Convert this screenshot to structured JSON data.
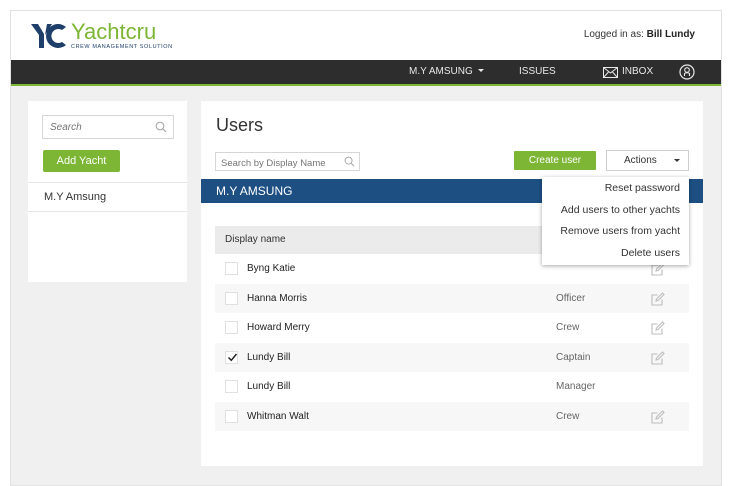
{
  "header": {
    "logo_name": "Yachtcru",
    "logo_tagline": "CREW MANAGEMENT SOLUTION",
    "logged_in_label": "Logged in as:",
    "logged_in_user": "Bill Lundy"
  },
  "nav": {
    "yacht": "M.Y AMSUNG",
    "issues": "ISSUES",
    "inbox": "INBOX"
  },
  "sidebar": {
    "search_placeholder": "Search",
    "add_yacht_label": "Add Yacht",
    "yachts": [
      "M.Y Amsung"
    ]
  },
  "main": {
    "title": "Users",
    "search_placeholder": "Search by Display Name",
    "create_user_label": "Create user",
    "actions_label": "Actions",
    "yacht_name": "M.Y AMSUNG",
    "table_header": "Display name",
    "rows": [
      {
        "name": "Byng Katie",
        "role": "",
        "checked": false,
        "editable": true
      },
      {
        "name": "Hanna Morris",
        "role": "Officer",
        "checked": false,
        "editable": true
      },
      {
        "name": "Howard Merry",
        "role": "Crew",
        "checked": false,
        "editable": true
      },
      {
        "name": "Lundy Bill",
        "role": "Captain",
        "checked": true,
        "editable": true
      },
      {
        "name": "Lundy Bill",
        "role": "Manager",
        "checked": false,
        "editable": false
      },
      {
        "name": "Whitman Walt",
        "role": "Crew",
        "checked": false,
        "editable": true
      }
    ]
  },
  "actions_menu": {
    "items": [
      "Reset password",
      "Add users to other yachts",
      "Remove users from yacht",
      "Delete users"
    ]
  },
  "colors": {
    "accent_green": "#7db535",
    "brand_blue": "#1d4f83",
    "navbar": "#2d2d2d"
  }
}
